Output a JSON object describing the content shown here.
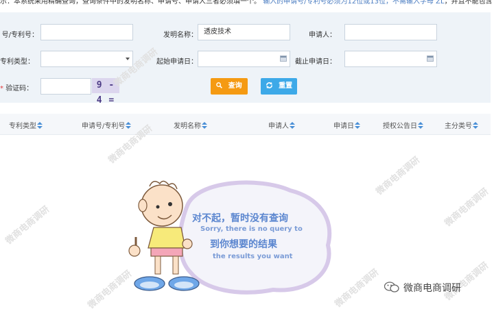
{
  "notice": {
    "text_dark": "示：本系统采用精确查询，查询条件中的发明名称、申请号、申请人三者必须填一个。",
    "text_blue": "输入的申请号/专利号必须为12位或13位，不需输入字母 ZL",
    "text_tail": "，并且不能包含"
  },
  "form": {
    "app_number_label": "号/专利号：",
    "app_number_value": "",
    "invention_name_label": "发明名称：",
    "invention_name_value": "透皮技术",
    "applicant_label": "申请人：",
    "applicant_value": "",
    "patent_type_label": "专利类型：",
    "patent_type_value": "",
    "start_date_label": "起始申请日：",
    "start_date_value": "",
    "end_date_label": "截止申请日：",
    "end_date_value": "",
    "captcha_required_mark": "*",
    "captcha_label": "验证码：",
    "captcha_value": "",
    "captcha_image_text": "9 - 4 =",
    "query_button": "查询",
    "reset_button": "重置"
  },
  "table": {
    "headers": [
      "专利类型",
      "申请号/专利号",
      "发明名称",
      "申请人",
      "申请日",
      "授权公告日",
      "主分类号"
    ]
  },
  "empty_state": {
    "title_cn": "对不起，暂时没有查询",
    "line1_en": "Sorry, there is no query to",
    "title2_cn": "到你想要的结果",
    "line2_en": "the results you want"
  },
  "watermark": {
    "text": "微商电商调研"
  },
  "brand": {
    "name": "微商电商调研"
  },
  "colors": {
    "query_button": "#f59a12",
    "reset_button": "#3da9e8",
    "sort_arrow": "#4a8fd6",
    "form_background": "#eef3f8"
  }
}
